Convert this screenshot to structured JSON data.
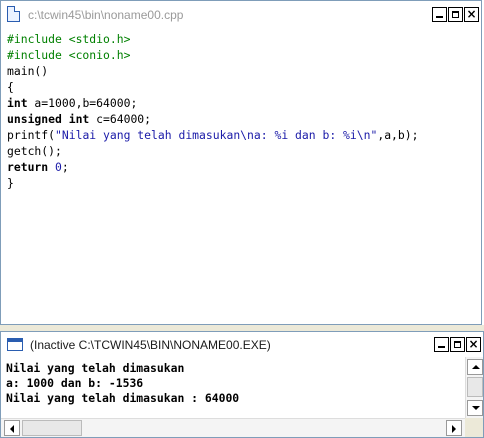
{
  "editor": {
    "title": "c:\\tcwin45\\bin\\noname00.cpp",
    "icon": "document-icon",
    "buttons": {
      "minimize": "minimize-icon",
      "maximize": "maximize-icon",
      "close": "close-icon"
    },
    "code": [
      {
        "text": "#include <stdio.h>"
      },
      {
        "text": "#include <conio.h>"
      },
      {
        "text": "main()"
      },
      {
        "text": "{"
      },
      {
        "kw": "int",
        "text": " a=1000,b=64000;"
      },
      {
        "kw": "unsigned int",
        "text": " c=64000;"
      },
      {
        "pre": "printf(",
        "str": "\"Nilai yang telah dimasukan\\na: %i dan b: %i\\n\"",
        "post": ",a,b);"
      },
      {
        "text": "getch();"
      },
      {
        "kw": "return",
        "pre": " ",
        "num": "0",
        "post": ";"
      },
      {
        "text": "}"
      }
    ]
  },
  "console": {
    "title": "(Inactive C:\\TCWIN45\\BIN\\NONAME00.EXE)",
    "icon": "console-window-icon",
    "lines": [
      "Nilai yang telah dimasukan",
      "a: 1000 dan b: -1536",
      "Nilai yang telah dimasukan : 64000"
    ]
  },
  "colors": {
    "preprocessor": "#008000",
    "string": "#1a1aa8",
    "border": "#7f9db9",
    "inactive_title": "#9a9a9a"
  }
}
